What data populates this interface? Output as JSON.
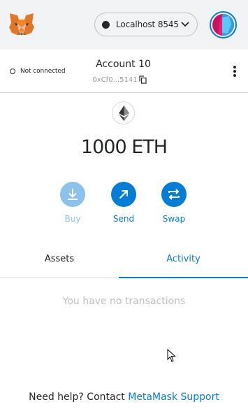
{
  "header": {
    "logo_icon": "metamask-fox-icon",
    "network": {
      "name": "Localhost 8545",
      "dot_color": "#24272a"
    },
    "avatar_icon": "account-identicon"
  },
  "account": {
    "connection_status": "Not connected",
    "name": "Account 10",
    "address_short": "0xCf0...5141",
    "copy_icon": "copy-icon",
    "menu_icon": "kebab-menu-icon"
  },
  "balance": {
    "token_icon": "ethereum-icon",
    "amount": "1000",
    "symbol": "ETH"
  },
  "actions": [
    {
      "label": "Buy",
      "icon": "download-arrow-icon",
      "color": "#8cc3ec"
    },
    {
      "label": "Send",
      "icon": "diagonal-arrow-icon",
      "color": "#037dd6"
    },
    {
      "label": "Swap",
      "icon": "swap-arrows-icon",
      "color": "#037dd6"
    }
  ],
  "tabs": [
    {
      "label": "Assets",
      "active": false
    },
    {
      "label": "Activity",
      "active": true
    }
  ],
  "activity": {
    "empty_message": "You have no transactions"
  },
  "footer": {
    "help_text": "Need help? Contact",
    "help_link": "MetaMask Support"
  },
  "colors": {
    "accent": "#037dd6",
    "header_bg": "#f2f3f4",
    "muted_text": "#bbc0c5"
  }
}
